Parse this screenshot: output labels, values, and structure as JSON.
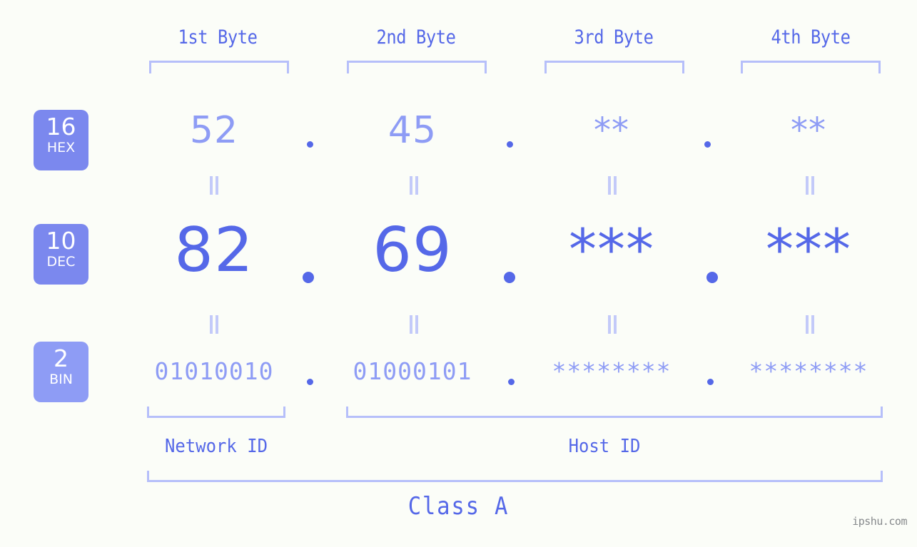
{
  "meta": {
    "background_color": "#fbfdf8",
    "accent_strong": "#5568e8",
    "accent_light": "#8e9cf5",
    "bracket_color": "#b6bffa",
    "badge_color": "#7b88ee",
    "badge_color_light": "#8e9cf5",
    "eq_color": "#c3caf9",
    "watermark_color": "#86898c"
  },
  "headers": [
    {
      "label": "1st Byte"
    },
    {
      "label": "2nd Byte"
    },
    {
      "label": "3rd Byte"
    },
    {
      "label": "4th Byte"
    }
  ],
  "bases": [
    {
      "number": "16",
      "abbr": "HEX"
    },
    {
      "number": "10",
      "abbr": "DEC"
    },
    {
      "number": "2",
      "abbr": "BIN"
    }
  ],
  "rows": {
    "hex": {
      "base_number": "16",
      "base_abbr": "HEX",
      "values": [
        "52",
        "45",
        "**",
        "**"
      ],
      "separators": [
        ".",
        ".",
        "."
      ]
    },
    "dec": {
      "base_number": "10",
      "base_abbr": "DEC",
      "values": [
        "82",
        "69",
        "***",
        "***"
      ],
      "separators": [
        ".",
        ".",
        "."
      ]
    },
    "bin": {
      "base_number": "2",
      "base_abbr": "BIN",
      "values": [
        "01010010",
        "01000101",
        "********",
        "********"
      ],
      "separators": [
        ".",
        ".",
        "."
      ]
    }
  },
  "equals_marks": {
    "glyph": "||",
    "count_per_row_gap": 4
  },
  "segments": {
    "network": {
      "label": "Network ID"
    },
    "host": {
      "label": "Host ID"
    }
  },
  "ip_class": {
    "label": "Class A"
  },
  "watermark": {
    "text": "ipshu.com"
  }
}
